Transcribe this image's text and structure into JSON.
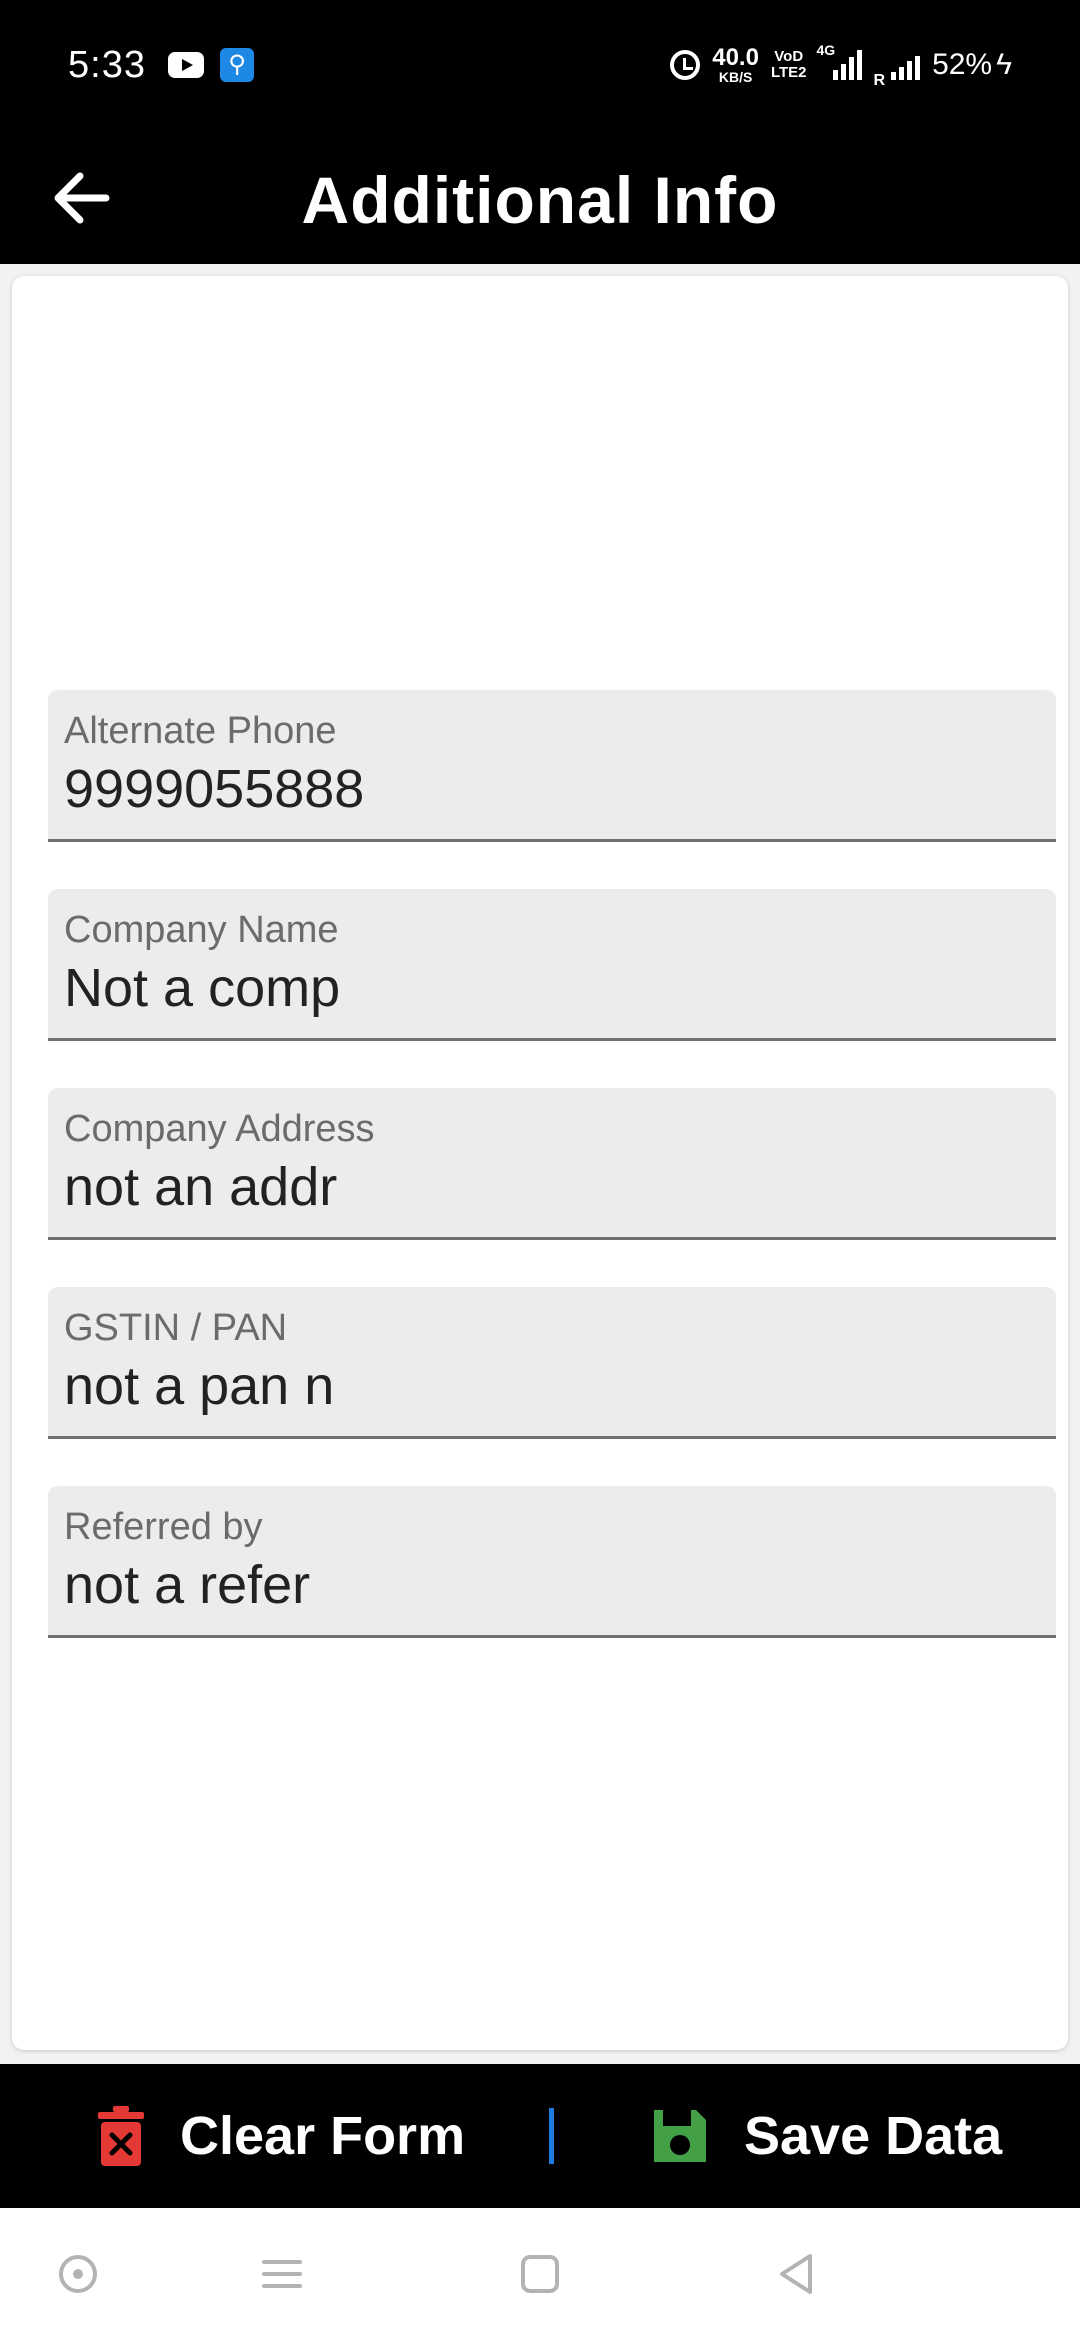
{
  "status_bar": {
    "time": "5:33",
    "net_speed_value": "40.0",
    "net_speed_unit": "KB/S",
    "volte_line1": "VoD",
    "volte_line2": "LTE2",
    "network_type": "4G",
    "roaming": "R",
    "battery": "52%",
    "icons": [
      "youtube-icon",
      "usb-icon",
      "alarm-icon",
      "signal-icon",
      "signal-icon",
      "charging-icon"
    ]
  },
  "app_bar": {
    "title": "Additional Info",
    "back_icon": "arrow-left-icon"
  },
  "form": {
    "fields": [
      {
        "label": "Alternate Phone",
        "value": "9999055888"
      },
      {
        "label": "Company Name",
        "value": "Not a comp"
      },
      {
        "label": "Company Address",
        "value": "not an addr"
      },
      {
        "label": "GSTIN / PAN",
        "value": "not a pan n"
      },
      {
        "label": "Referred by",
        "value": "not a refer"
      }
    ]
  },
  "bottom_bar": {
    "clear_label": "Clear Form",
    "clear_icon": "trash-x-icon",
    "save_label": "Save Data",
    "save_icon": "floppy-disk-icon"
  },
  "colors": {
    "bar_background": "#000000",
    "field_background": "#ececec",
    "divider": "#1e7be0",
    "clear_icon": "#e53935",
    "save_icon": "#43a047"
  },
  "nav_bar": {
    "items": [
      "assistant-icon",
      "menu-icon",
      "home-square-icon",
      "back-triangle-icon"
    ]
  }
}
